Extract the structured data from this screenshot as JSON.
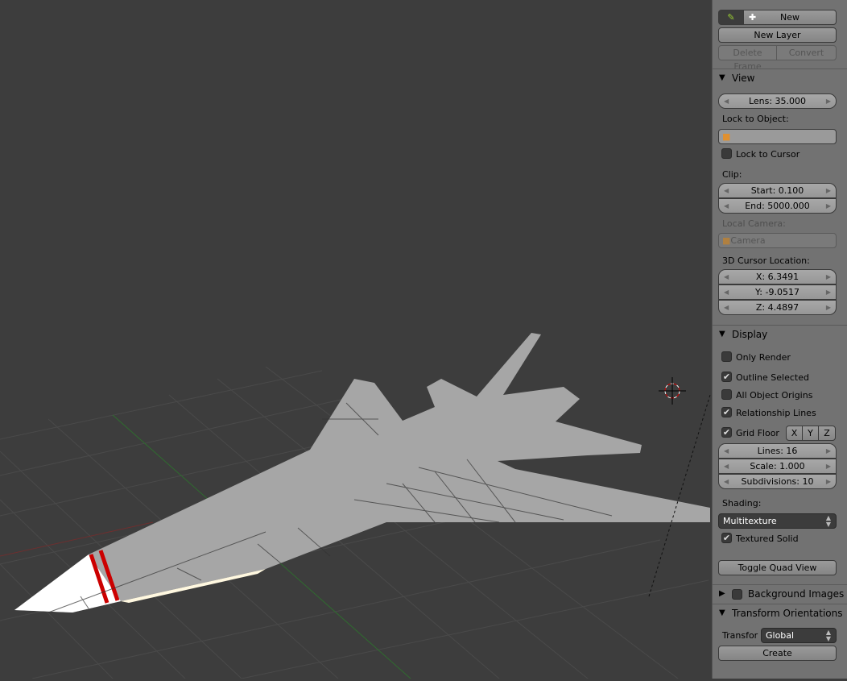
{
  "grease_pencil": {
    "draw_icon": "pencil-icon",
    "new_label": "New",
    "new_layer_label": "New Layer",
    "delete_frame_label": "Delete Frame",
    "convert_label": "Convert"
  },
  "view": {
    "title": "View",
    "lens": "Lens: 35.000",
    "lock_to_object_label": "Lock to Object:",
    "lock_to_cursor_label": "Lock to Cursor",
    "lock_to_cursor": false,
    "clip_label": "Clip:",
    "clip_start": "Start: 0.100",
    "clip_end": "End: 5000.000",
    "local_camera_label": "Local Camera:",
    "local_camera_value": "Camera",
    "cursor_location_label": "3D Cursor Location:",
    "cursor_x": "X: 6.3491",
    "cursor_y": "Y: -9.0517",
    "cursor_z": "Z: 4.4897"
  },
  "display": {
    "title": "Display",
    "only_render": "Only Render",
    "outline_selected": "Outline Selected",
    "all_object_origins": "All Object Origins",
    "relationship_lines": "Relationship Lines",
    "grid_floor": "Grid Floor",
    "axis_x": "X",
    "axis_y": "Y",
    "axis_z": "Z",
    "lines": "Lines: 16",
    "scale": "Scale: 1.000",
    "subdivisions": "Subdivisions: 10",
    "shading_label": "Shading:",
    "shading_value": "Multitexture",
    "textured_solid": "Textured Solid",
    "toggle_quad_view": "Toggle Quad View"
  },
  "background_images": {
    "title": "Background Images"
  },
  "transform_orientations": {
    "title": "Transform Orientations",
    "transform_label": "Transfor",
    "transform_value": "Global",
    "create_label": "Create"
  },
  "colors": {
    "viewport": "#3d3d3d",
    "panel": "#727272",
    "stripe": "#cc0000"
  }
}
